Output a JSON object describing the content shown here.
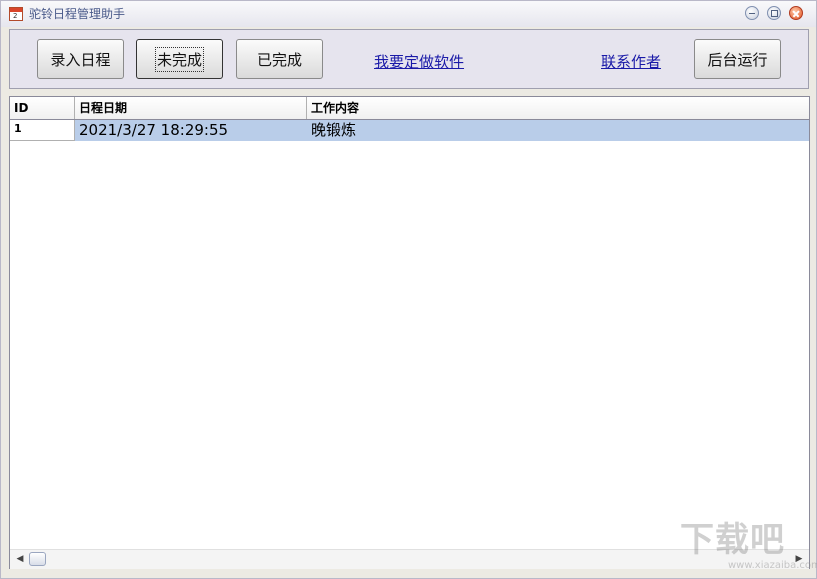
{
  "window": {
    "title": "驼铃日程管理助手"
  },
  "toolbar": {
    "add_schedule": "录入日程",
    "incomplete": "未完成",
    "completed": "已完成",
    "custom_software_link": "我要定做软件",
    "contact_author_link": "联系作者",
    "run_background": "后台运行"
  },
  "grid": {
    "columns": [
      "ID",
      "日程日期",
      "工作内容"
    ],
    "rows": [
      {
        "id": "1",
        "date": "2021/3/27 18:29:55",
        "content": "晚锻炼"
      }
    ]
  },
  "watermark": {
    "text": "下载吧",
    "url": "www.xiazaiba.com"
  },
  "colors": {
    "selection": "#b9cde9",
    "link": "#1a1aa8",
    "close_button": "#e0501f"
  }
}
